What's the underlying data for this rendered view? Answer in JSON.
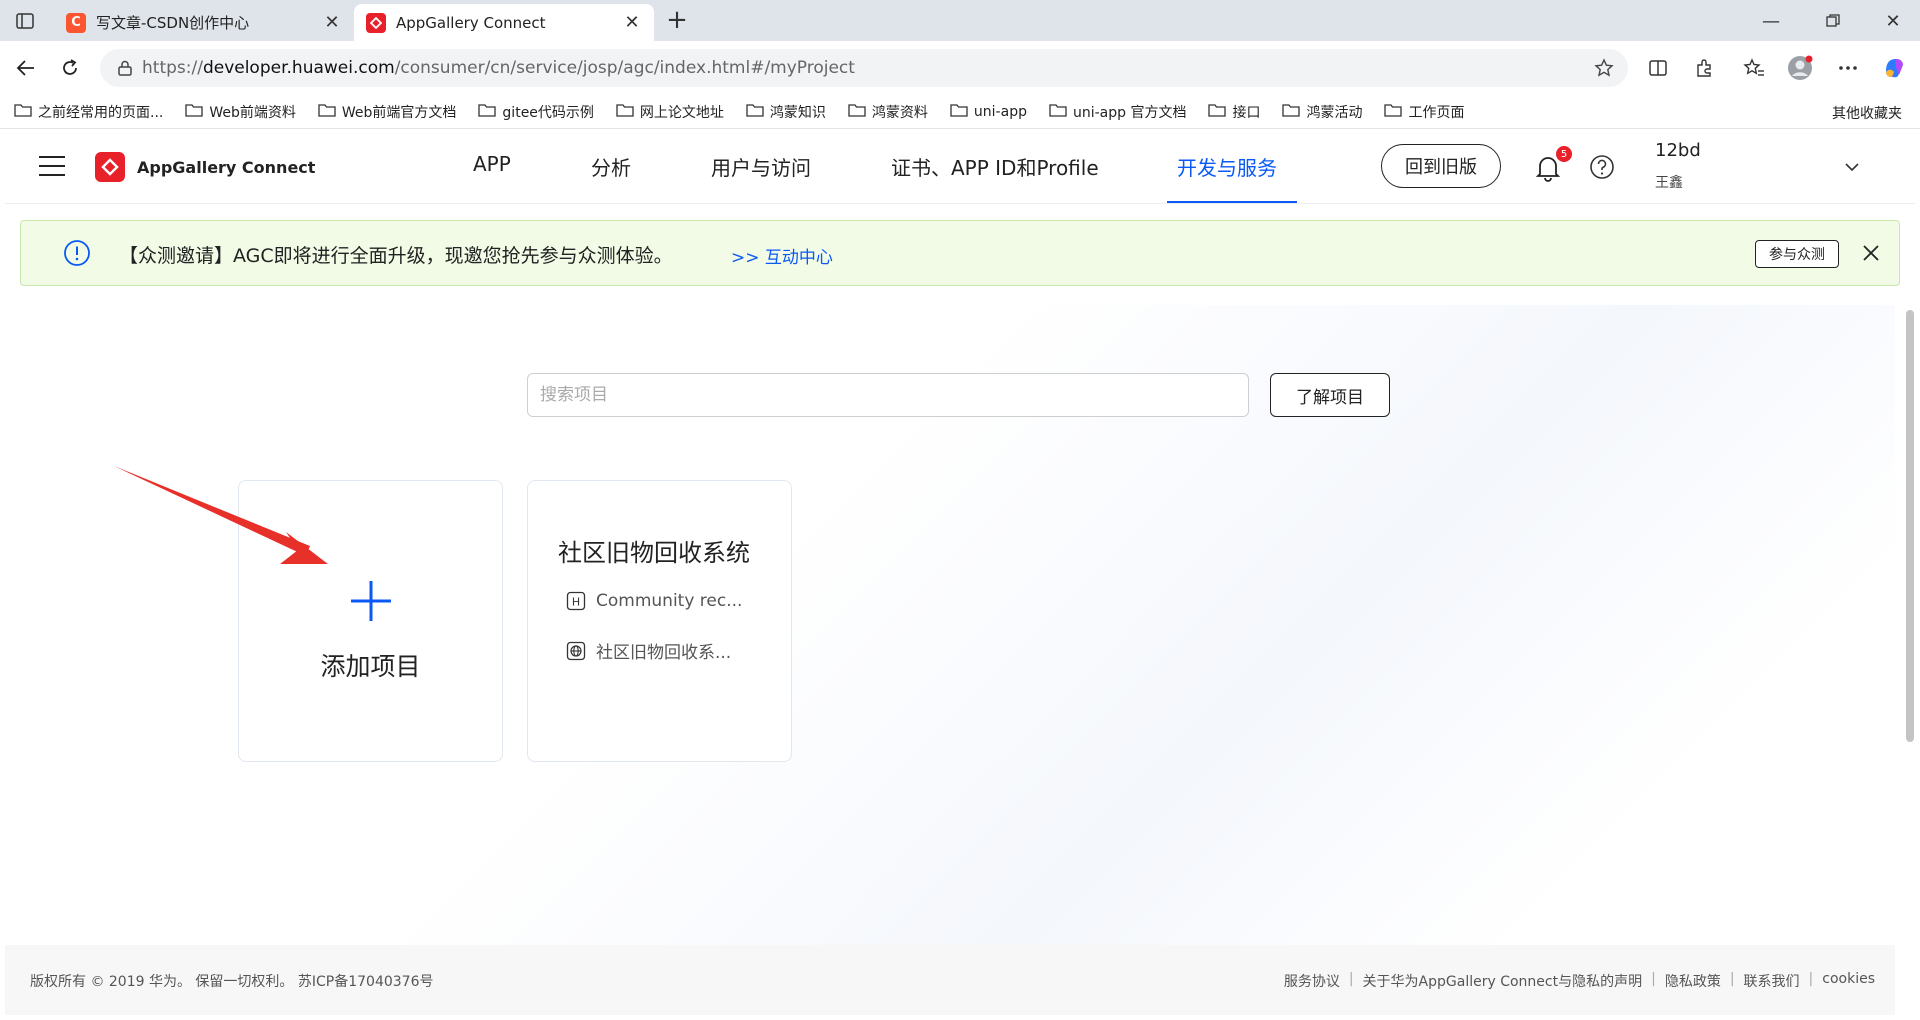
{
  "browser": {
    "tabs": [
      {
        "title": "写文章-CSDN创作中心",
        "favicon_letter": "C"
      },
      {
        "title": "AppGallery Connect"
      }
    ],
    "url_prefix": "https://",
    "url_host": "developer.huawei.com",
    "url_path": "/consumer/cn/service/josp/agc/index.html#/myProject",
    "bookmarks": [
      "之前经常用的页面...",
      "Web前端资料",
      "Web前端官方文档",
      "gitee代码示例",
      "网上论文地址",
      "鸿蒙知识",
      "鸿蒙资料",
      "uni-app",
      "uni-app 官方文档",
      "接口",
      "鸿蒙活动",
      "工作页面"
    ],
    "other_bookmarks": "其他收藏夹"
  },
  "header": {
    "logo_text": "AppGallery Connect",
    "nav": [
      "APP",
      "分析",
      "用户与访问",
      "证书、APP ID和Profile",
      "开发与服务"
    ],
    "active_nav": "开发与服务",
    "old_version_label": "回到旧版",
    "notification_count": "5",
    "user_name": "12bd",
    "user_realname": "王鑫"
  },
  "notice": {
    "text": "【众测邀请】AGC即将进行全面升级，现邀您抢先参与众测体验。",
    "link": ">> 互动中心",
    "button": "参与众测"
  },
  "main": {
    "search_placeholder": "搜索项目",
    "learn_button": "了解项目",
    "add_card_label": "添加项目",
    "project": {
      "title": "社区旧物回收系统",
      "package": "Community rec...",
      "name": "社区旧物回收系..."
    }
  },
  "footer": {
    "copyright": "版权所有 © 2019 华为。 保留一切权利。 苏ICP备17040376号",
    "links": [
      "服务协议",
      "关于华为AppGallery Connect与隐私的声明",
      "隐私政策",
      "联系我们",
      "cookies"
    ]
  },
  "colors": {
    "accent": "#0a59f7",
    "brand_red": "#e8202a",
    "notice_bg": "#f1fbe6",
    "annotation_arrow": "#e8302a"
  }
}
